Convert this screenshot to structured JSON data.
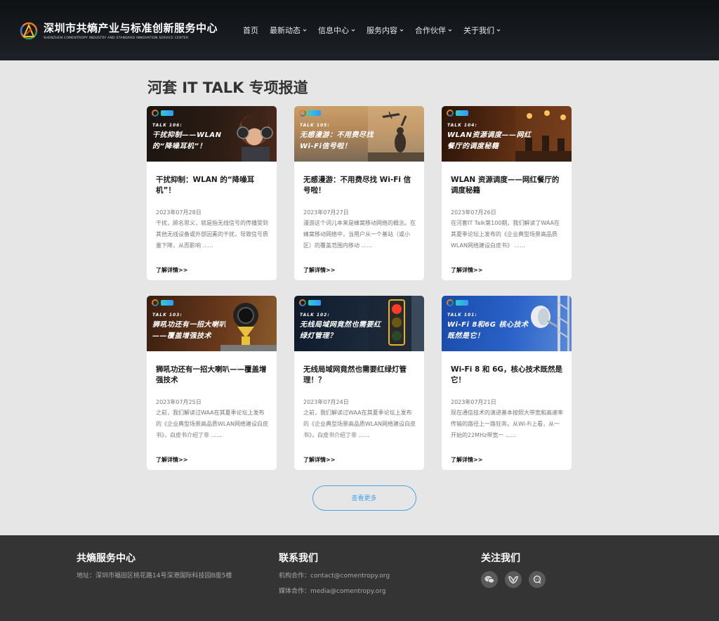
{
  "header": {
    "logo_cn": "深圳市共熵产业与标准创新服务中心",
    "logo_en": "SHENZHEN COMENTROPY INDUSTRY AND STANDARD INNOVATION SERVICE CENTER",
    "nav": [
      {
        "label": "首页"
      },
      {
        "label": "最新动态"
      },
      {
        "label": "信息中心"
      },
      {
        "label": "服务内容"
      },
      {
        "label": "合作伙伴"
      },
      {
        "label": "关于我们"
      }
    ]
  },
  "page": {
    "title": "河套 IT TALK 专项报道"
  },
  "cards": [
    {
      "talk": "TALK 106:",
      "thumb_title": "干扰抑制——WLAN 的“降噪耳机”！",
      "title": "干扰抑制：WLAN 的“降噪耳机”！",
      "date": "2023年07月28日",
      "excerpt": "干扰，顾名思义，就是指无线信号的传播受到其他无线设备或外部因素的干扰，导致信号质量下降，从而影响 ......",
      "more": "了解详情>>"
    },
    {
      "talk": "TALK 105:",
      "thumb_title": "无感漫游：不用费尽找Wi-Fi信号啦！",
      "title": "无感漫游：不用费尽找 Wi-Fi 信号啦！",
      "date": "2023年07月27日",
      "excerpt": "漫游这个词儿本来是蜂窝移动网络的概念。在蜂窝移动网络中，当用户从一个基站（或小区）的覆盖范围内移动 ......",
      "more": "了解详情>>"
    },
    {
      "talk": "TALK 104:",
      "thumb_title": "WLAN资源调度——网红餐厅的调度秘籍",
      "title": "WLAN 资源调度——网红餐厅的调度秘籍",
      "date": "2023年07月26日",
      "excerpt": "在河套IT Talk第100期，我们解读了WAA在其夏季论坛上发布的《企业典型场景高品质WLAN网络建设白皮书》 ......",
      "more": "了解详情>>"
    },
    {
      "talk": "TALK 103:",
      "thumb_title": "狮吼功还有一招大喇叭——覆盖增强技术",
      "title": "狮吼功还有一招大喇叭——覆盖增强技术",
      "date": "2023年07月25日",
      "excerpt": "之前，我们解读过WAA在其夏季论坛上发布的《企业典型场景高品质WLAN网络建设白皮书》，白皮书介绍了非 ......",
      "more": "了解详情>>"
    },
    {
      "talk": "TALK 102:",
      "thumb_title": "无线局域网竟然也需要红绿灯管理？",
      "title": "无线局域网竟然也需要红绿灯管理！？",
      "date": "2023年07月24日",
      "excerpt": "之前，我们解读过WAA在其夏季论坛上发布的《企业典型场景高品质WLAN网络建设白皮书》，白皮书介绍了非 ......",
      "more": "了解详情>>"
    },
    {
      "talk": "TALK 101:",
      "thumb_title": "Wi-Fi 8和6G 核心技术既然是它！",
      "title": "Wi-Fi 8 和 6G，核心技术既然是它！",
      "date": "2023年07月21日",
      "excerpt": "现在通信技术的演进基本按照大带宽和高速率传输的路径上一路狂奔。从Wi-Fi上看，从一开始的22MHz带宽一 ......",
      "more": "了解详情>>"
    }
  ],
  "load_more": "查看更多",
  "footer": {
    "col1": {
      "title": "共熵服务中心",
      "address": "地址：深圳市福田区桃花路14号深港国际科技园B座5楼"
    },
    "col2": {
      "title": "联系我们",
      "line1": "机构合作：contact@comentropy.org",
      "line2": "媒体合作：media@comentropy.org"
    },
    "col3": {
      "title": "关注我们"
    },
    "social": [
      {
        "icon": "wechat-icon"
      },
      {
        "icon": "weibo-icon"
      },
      {
        "icon": "chat-icon"
      }
    ]
  },
  "colors": {
    "header_bg": "#16191d",
    "page_bg": "#e6e6e6",
    "accent": "#4aa3e8",
    "footer_bg": "#343434"
  }
}
